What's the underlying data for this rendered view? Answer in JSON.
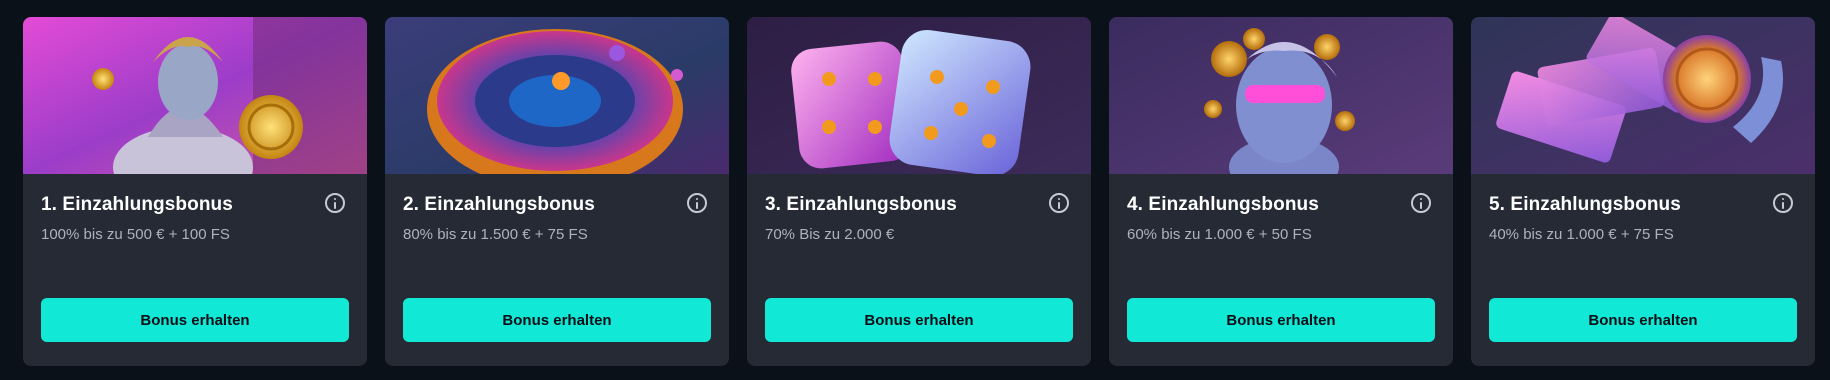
{
  "cards": [
    {
      "title": "1. Einzahlungsbonus",
      "subtitle": "100% bis zu 500 € + 100 FS",
      "button": "Bonus erhalten",
      "image": "goddess-with-gold-coin"
    },
    {
      "title": "2. Einzahlungsbonus",
      "subtitle": "80% bis zu 1.500 € + 75 FS",
      "button": "Bonus erhalten",
      "image": "neon-roulette-wheel"
    },
    {
      "title": "3. Einzahlungsbonus",
      "subtitle": "70% Bis zu 2.000 €",
      "button": "Bonus erhalten",
      "image": "neon-dice"
    },
    {
      "title": "4. Einzahlungsbonus",
      "subtitle": "60% bis zu 1.000 € + 50 FS",
      "button": "Bonus erhalten",
      "image": "statue-with-sunglasses-and-coins"
    },
    {
      "title": "5. Einzahlungsbonus",
      "subtitle": "40% bis zu 1.000 € + 75 FS",
      "button": "Bonus erhalten",
      "image": "hand-with-money-and-coin"
    }
  ],
  "colors": {
    "page_bg": "#0b1119",
    "card_bg": "#262a35",
    "button_bg": "#12e8d6",
    "title": "#ffffff",
    "subtitle": "#aeb2bd"
  }
}
